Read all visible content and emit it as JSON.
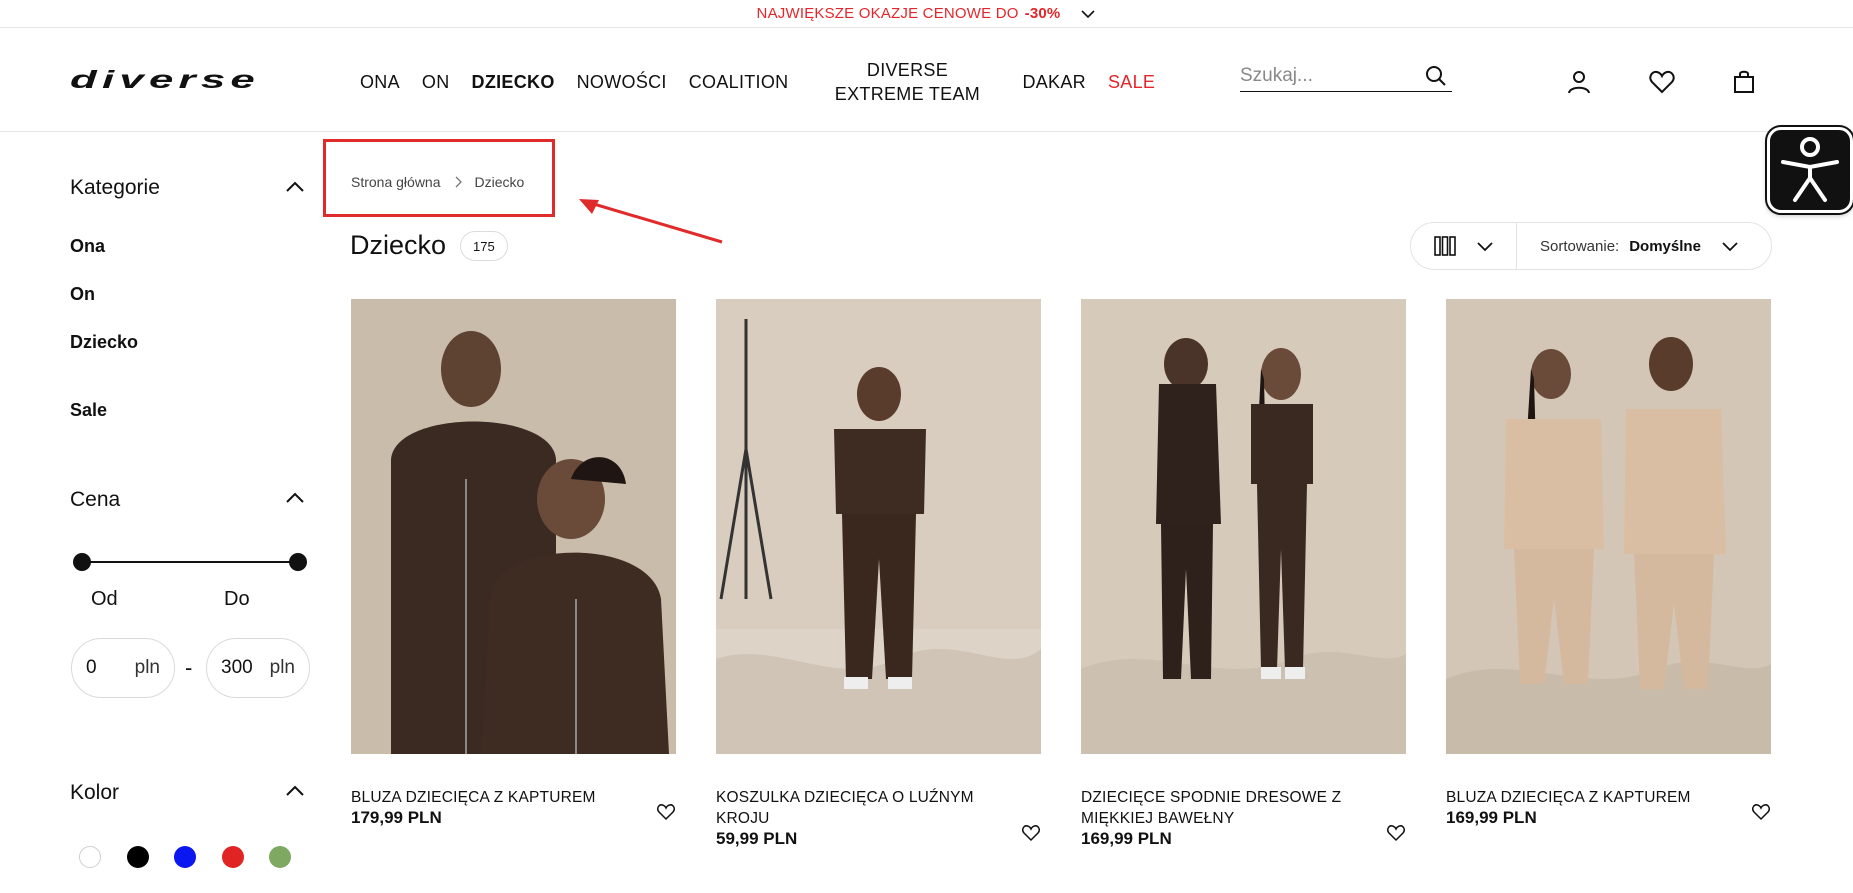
{
  "promo": {
    "text": "NAJWIĘKSZE OKAZJE CENOWE DO",
    "highlight": "-30%"
  },
  "header": {
    "logo": "diverse",
    "nav": [
      "ONA",
      "ON",
      "DZIECKO",
      "NOWOŚCI",
      "COALITION",
      "DIVERSE EXTREME TEAM",
      "DAKAR",
      "SALE"
    ],
    "search_placeholder": "Szukaj..."
  },
  "sidebar": {
    "categories_heading": "Kategorie",
    "categories": [
      "Ona",
      "On",
      "Dziecko",
      "Sale"
    ],
    "price_heading": "Cena",
    "price_from_label": "Od",
    "price_to_label": "Do",
    "price_from": "0",
    "price_to": "300",
    "currency": "pln",
    "color_heading": "Kolor",
    "colors": [
      "#ffffff",
      "#000000",
      "#0a17f0",
      "#e02424",
      "#7fa862"
    ]
  },
  "breadcrumb": {
    "home": "Strona główna",
    "current": "Dziecko"
  },
  "listing": {
    "title": "Dziecko",
    "count": "175",
    "sort_label": "Sortowanie:",
    "sort_value": "Domyślne"
  },
  "products": [
    {
      "name": "BLUZA DZIECIĘCA Z KAPTUREM",
      "price": "179,99 PLN"
    },
    {
      "name": "KOSZULKA DZIECIĘCA O LUŹNYM KROJU",
      "price": "59,99 PLN"
    },
    {
      "name": "DZIECIĘCE SPODNIE DRESOWE Z MIĘKKIEJ BAWEŁNY",
      "price": "169,99 PLN"
    },
    {
      "name": "BLUZA DZIECIĘCA Z KAPTUREM",
      "price": "169,99 PLN"
    }
  ],
  "annotation_color": "#e02b2b"
}
